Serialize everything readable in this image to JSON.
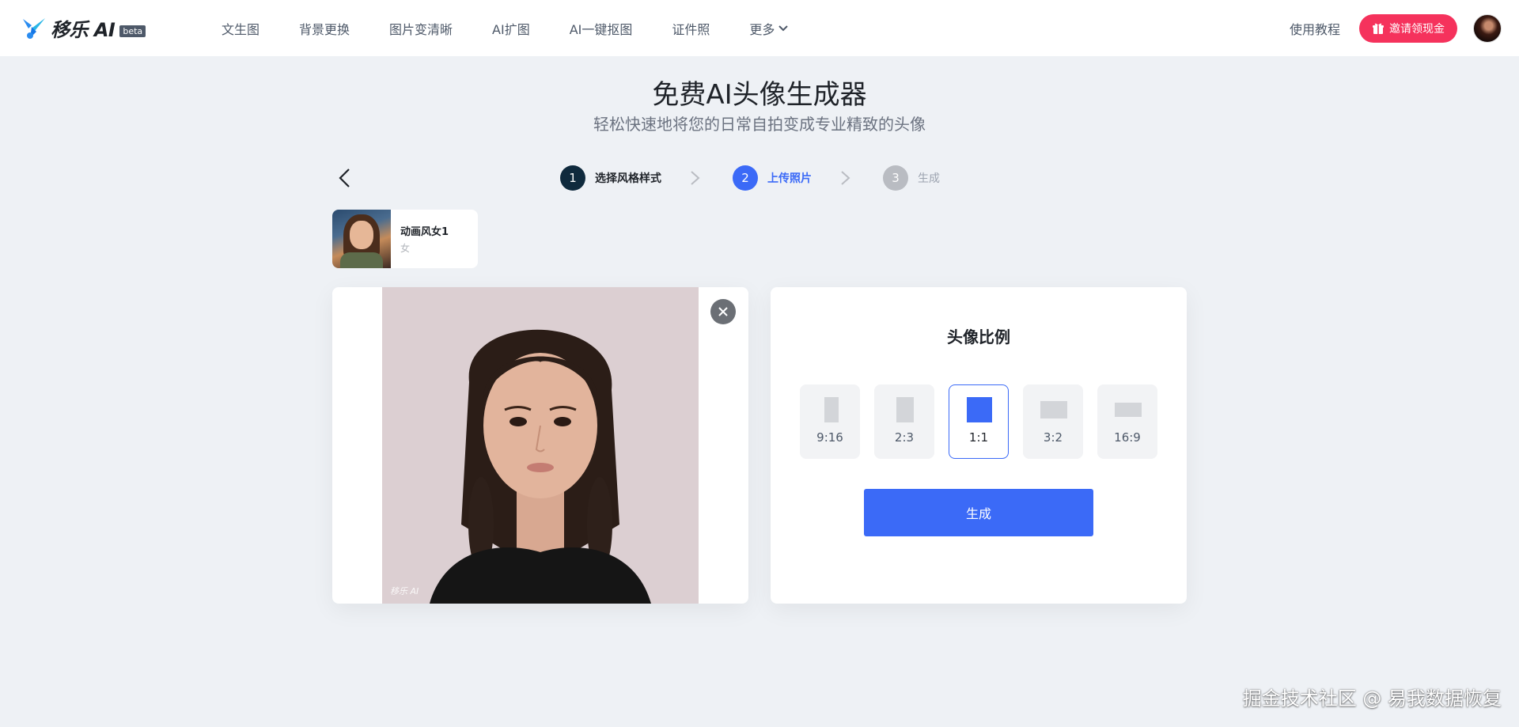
{
  "header": {
    "logo_text": "移乐 AI",
    "beta_badge": "beta",
    "nav_items": [
      "文生图",
      "背景更换",
      "图片变清晰",
      "AI扩图",
      "AI一键抠图",
      "证件照",
      "更多"
    ],
    "tutorial_link": "使用教程",
    "invite_button": "邀请领现金"
  },
  "page": {
    "title": "免费AI头像生成器",
    "subtitle": "轻松快速地将您的日常自拍变成专业精致的头像"
  },
  "steps": [
    {
      "num": "1",
      "label": "选择风格样式",
      "state": "done"
    },
    {
      "num": "2",
      "label": "上传照片",
      "state": "active"
    },
    {
      "num": "3",
      "label": "生成",
      "state": "todo"
    }
  ],
  "style_card": {
    "name": "动画风女1",
    "gender": "女"
  },
  "photo": {
    "watermark": "移乐 AI"
  },
  "ratio_panel": {
    "title": "头像比例",
    "options": [
      {
        "label": "9:16",
        "selected": false
      },
      {
        "label": "2:3",
        "selected": false
      },
      {
        "label": "1:1",
        "selected": true
      },
      {
        "label": "3:2",
        "selected": false
      },
      {
        "label": "16:9",
        "selected": false
      }
    ],
    "generate_button": "生成"
  },
  "site_watermark": "掘金技术社区 @ 易我数据恢复",
  "colors": {
    "accent": "#3b6af7",
    "invite": "#f5325c",
    "background": "#eef1f5",
    "step_done": "#0f2a3d"
  }
}
